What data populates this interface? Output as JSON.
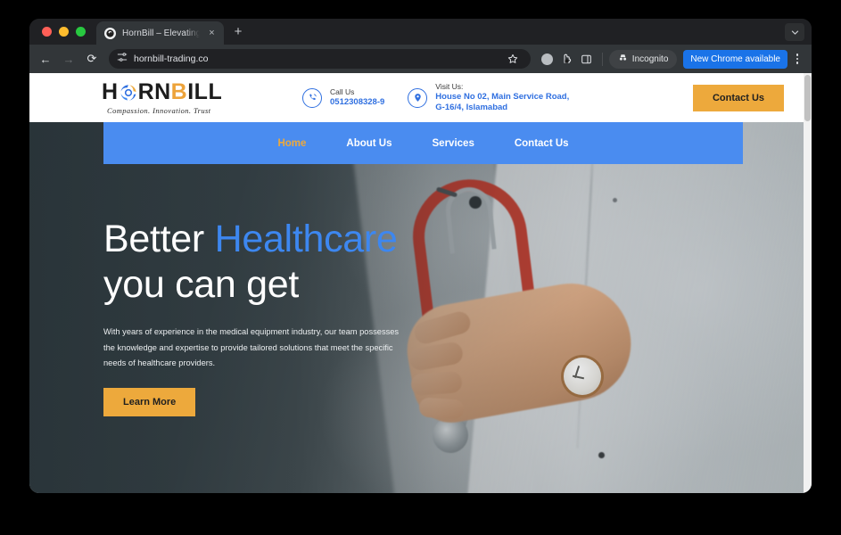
{
  "browser": {
    "tab": {
      "title": "HornBill – Elevating Healthca",
      "favicon_icon": "hornbill-favicon",
      "close_icon": "×"
    },
    "new_tab_icon": "+",
    "tab_list_icon": "chevron-down-icon",
    "toolbar": {
      "back_icon": "←",
      "forward_icon": "→",
      "reload_icon": "⟳",
      "site_settings_icon": "tune-icon",
      "url": "hornbill-trading.co",
      "bookmark_icon": "star-icon",
      "extensions_icon": "extension-icon",
      "split_icon": "split-screen-icon",
      "profile_icon": "profile-avatar-icon",
      "incognito_label": "Incognito",
      "incognito_icon": "incognito-hat-icon",
      "chrome_update_label": "New Chrome available",
      "menu_icon": "kebab-menu-icon"
    }
  },
  "site": {
    "logo": {
      "text_part1": "H",
      "text_part2": "RN",
      "text_part3": "B",
      "text_part4": "ILL",
      "o_icon": "hornbill-swirl-icon",
      "tagline": "Compassion. Innovation. Trust"
    },
    "contacts": [
      {
        "icon": "phone-icon",
        "label": "Call Us",
        "value": "0512308328-9"
      },
      {
        "icon": "location-pin-icon",
        "label": "Visit Us:",
        "value": "House No 02, Main Service Road, G-16/4, Islamabad"
      }
    ],
    "header_cta": "Contact Us",
    "nav": [
      {
        "label": "Home",
        "active": true
      },
      {
        "label": "About Us",
        "active": false
      },
      {
        "label": "Services",
        "active": false
      },
      {
        "label": "Contact Us",
        "active": false
      }
    ],
    "hero": {
      "heading_line1_plain": "Better ",
      "heading_line1_highlight": "Healthcare",
      "heading_line2": "you can get",
      "paragraph": "With years of experience in the medical equipment industry, our team possesses the knowledge and expertise to provide tailored solutions that meet the specific needs of healthcare providers.",
      "cta": "Learn More"
    }
  },
  "colors": {
    "brand_blue": "#4a8cf0",
    "brand_amber": "#eda93c",
    "link_blue": "#2f6fe0",
    "heading_highlight": "#3d87f0",
    "chrome_update_blue": "#1a73e8"
  }
}
